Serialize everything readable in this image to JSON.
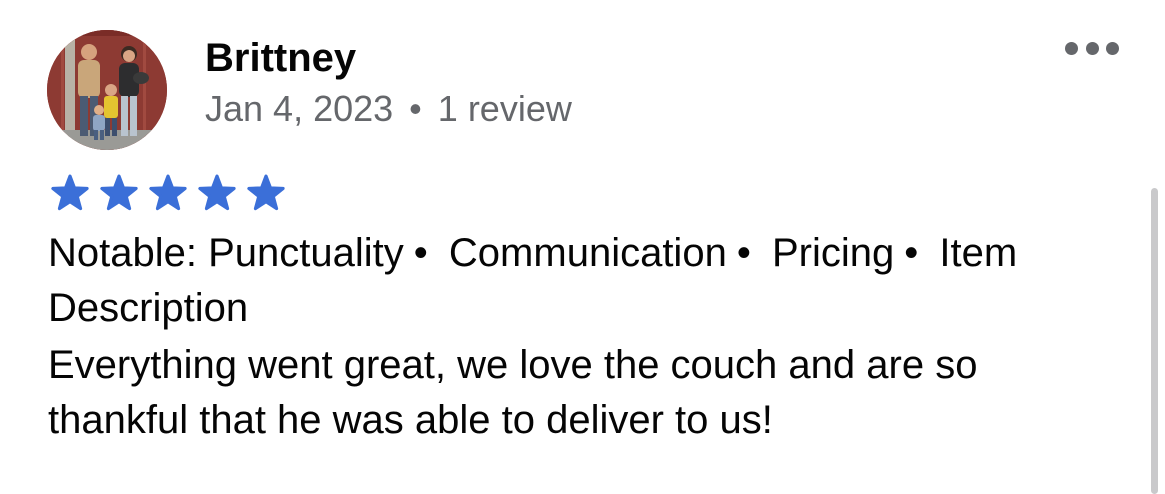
{
  "review": {
    "reviewer_name": "Brittney",
    "date": "Jan 4, 2023",
    "separator": "•",
    "review_count": "1 review",
    "rating": 5,
    "rating_max": 5,
    "notable_prefix": "Notable:",
    "notable_tags": [
      "Punctuality",
      "Communication",
      "Pricing",
      "Item Description"
    ],
    "text": "Everything went great, we love the couch and are so thankful that he was able to deliver to us!"
  },
  "icons": {
    "more": "more-options-icon",
    "star": "star-icon",
    "avatar": "avatar-photo"
  },
  "colors": {
    "star": "#3b6fd8",
    "secondary_text": "#65676b",
    "primary_text": "#050505"
  }
}
